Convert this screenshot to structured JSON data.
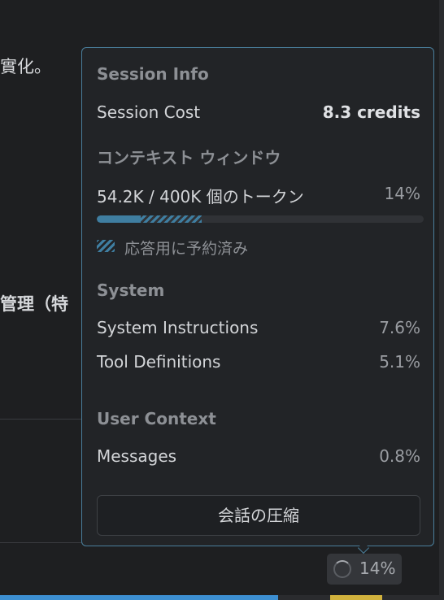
{
  "background": {
    "fragment_1": "實化。",
    "fragment_2": "管理（特"
  },
  "popover": {
    "session_info": {
      "heading": "Session Info",
      "cost_label": "Session Cost",
      "cost_value": "8.3 credits"
    },
    "context_window": {
      "heading": "コンテキスト ウィンドウ",
      "tokens_text": "54.2K / 400K 個のトークン",
      "percent": "14%",
      "used_fraction": 0.135,
      "reserved_fraction": 0.32,
      "reserved_label": "応答用に予約済み"
    },
    "system": {
      "heading": "System",
      "items": [
        {
          "label": "System Instructions",
          "value": "7.6%"
        },
        {
          "label": "Tool Definitions",
          "value": "5.1%"
        }
      ]
    },
    "user_context": {
      "heading": "User Context",
      "items": [
        {
          "label": "Messages",
          "value": "0.8%"
        }
      ]
    },
    "compact_button": "会話の圧縮"
  },
  "status": {
    "percent": "14%"
  },
  "colors": {
    "accent": "#3f7ea1",
    "popover_border": "#4a7f9c",
    "status_bar_blue": "#3d8fd1",
    "status_bar_yellow": "#d1b23d"
  }
}
